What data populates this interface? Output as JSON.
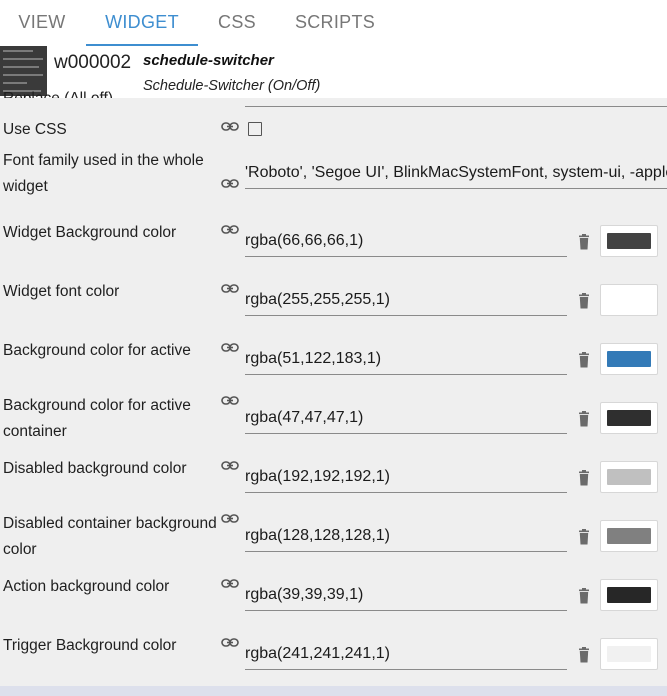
{
  "tabs": [
    {
      "label": "VIEW"
    },
    {
      "label": "WIDGET"
    },
    {
      "label": "CSS"
    },
    {
      "label": "SCRIPTS"
    }
  ],
  "header": {
    "widget_id": "w000002",
    "widget_name": "schedule-switcher",
    "widget_desc": "Schedule-Switcher (On/Off)"
  },
  "cut_label": "Replace (All off)",
  "use_css_label": "Use CSS",
  "font_family": {
    "label": "Font family used in the whole widget",
    "value": "'Roboto', 'Segoe UI', BlinkMacSystemFont, system-ui, -apple-system"
  },
  "color_rows": [
    {
      "label": "Widget Background color",
      "value": "rgba(66,66,66,1)",
      "color": "#424242"
    },
    {
      "label": "Widget font color",
      "value": "rgba(255,255,255,1)",
      "color": "#ffffff"
    },
    {
      "label": "Background color for active",
      "value": "rgba(51,122,183,1)",
      "color": "#337ab7"
    },
    {
      "label": "Background color for active container",
      "value": "rgba(47,47,47,1)",
      "color": "#2f2f2f"
    },
    {
      "label": "Disabled background color",
      "value": "rgba(192,192,192,1)",
      "color": "#c0c0c0"
    },
    {
      "label": "Disabled container background color",
      "value": "rgba(128,128,128,1)",
      "color": "#808080"
    },
    {
      "label": "Action background color",
      "value": "rgba(39,39,39,1)",
      "color": "#272727"
    },
    {
      "label": "Trigger Background color",
      "value": "rgba(241,241,241,1)",
      "color": "#f1f1f1"
    }
  ]
}
